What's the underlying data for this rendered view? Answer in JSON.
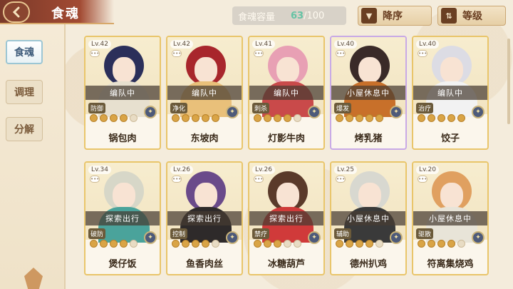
{
  "header": {
    "title": "食魂",
    "back_icon": "back-arrow-icon"
  },
  "sidebar": {
    "items": [
      {
        "label": "食魂",
        "active": true
      },
      {
        "label": "调理",
        "active": false
      },
      {
        "label": "分解",
        "active": false
      }
    ]
  },
  "capacity": {
    "label": "食魂容量",
    "current": "63",
    "max": "/100"
  },
  "sort_order": {
    "label": "降序",
    "icon": "chevron-down-icon"
  },
  "sort_key": {
    "label": "等级",
    "icon": "sort-arrows-icon"
  },
  "cards": [
    {
      "level": "Lv.42",
      "status": "编队中",
      "role": "防御",
      "stars": 4,
      "name": "锅包肉",
      "frame": "gold",
      "hair": "#2b2f5a",
      "outfit": "#e7e0cf"
    },
    {
      "level": "Lv.42",
      "status": "编队中",
      "role": "净化",
      "stars": 5,
      "name": "东坡肉",
      "frame": "gold",
      "hair": "#a8262c",
      "outfit": "#e9c07a"
    },
    {
      "level": "Lv.41",
      "status": "编队中",
      "role": "刺杀",
      "stars": 4,
      "name": "灯影牛肉",
      "frame": "gold",
      "hair": "#e8a0b4",
      "outfit": "#c94a4a"
    },
    {
      "level": "Lv.40",
      "status": "小屋休息中",
      "role": "爆发",
      "stars": 5,
      "name": "烤乳猪",
      "frame": "rainbow",
      "hair": "#3a2a28",
      "outfit": "#c8702a"
    },
    {
      "level": "Lv.40",
      "status": "编队中",
      "role": "治疗",
      "stars": 5,
      "name": "饺子",
      "frame": "gold",
      "hair": "#dcdce4",
      "outfit": "#f2f2f2"
    },
    {
      "level": "Lv.34",
      "status": "探索出行",
      "role": "破防",
      "stars": 4,
      "name": "煲仔饭",
      "frame": "gold",
      "hair": "#d7d7c8",
      "outfit": "#4aa39b"
    },
    {
      "level": "Lv.26",
      "status": "探索出行",
      "role": "控制",
      "stars": 4,
      "name": "鱼香肉丝",
      "frame": "gold",
      "hair": "#6a4a8a",
      "outfit": "#2e2a2a"
    },
    {
      "level": "Lv.26",
      "status": "探索出行",
      "role": "禁疗",
      "stars": 3,
      "name": "冰糖葫芦",
      "frame": "gold",
      "hair": "#5a3a2a",
      "outfit": "#d03a3a"
    },
    {
      "level": "Lv.25",
      "status": "小屋休息中",
      "role": "辅助",
      "stars": 4,
      "name": "德州扒鸡",
      "frame": "gold",
      "hair": "#d8d8d0",
      "outfit": "#3a3a3a"
    },
    {
      "level": "Lv.20",
      "status": "小屋休息中",
      "role": "驱散",
      "stars": 4,
      "name": "符离集烧鸡",
      "frame": "gold",
      "hair": "#e0a060",
      "outfit": "#e8e4d8"
    }
  ]
}
